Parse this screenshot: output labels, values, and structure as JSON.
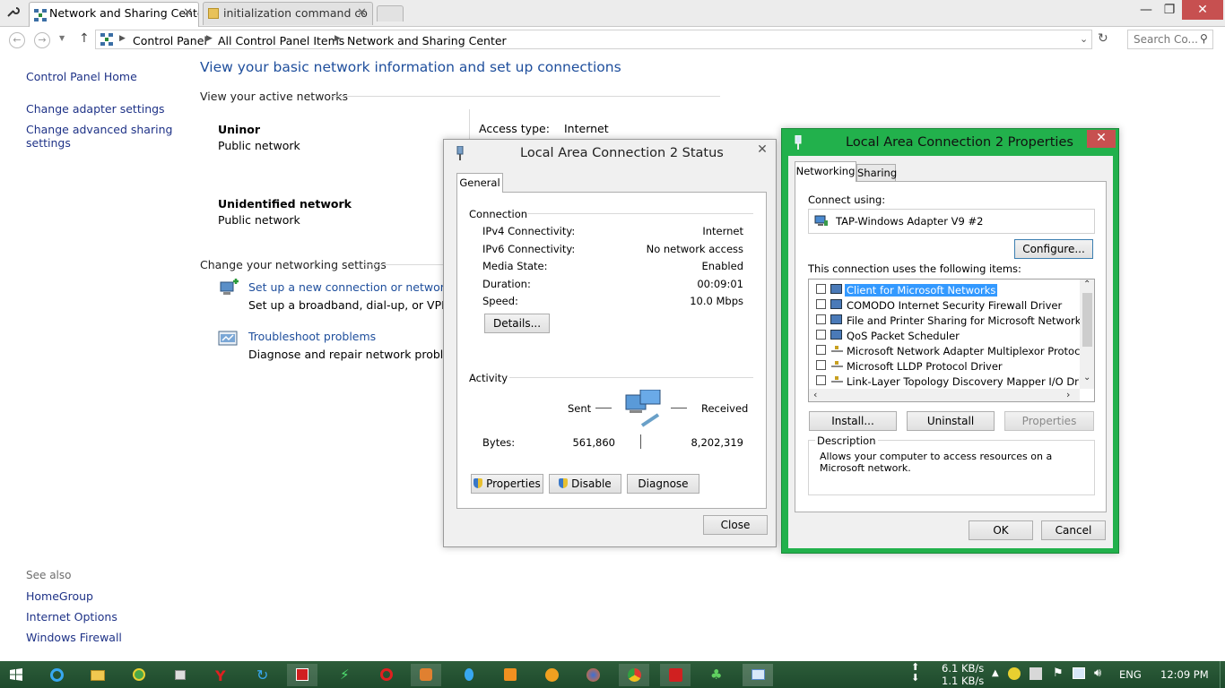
{
  "browser": {
    "tabs": [
      {
        "label": "Network and Sharing Cente",
        "active": true
      },
      {
        "label": "initialization command co",
        "active": false
      }
    ]
  },
  "address": {
    "crumbs": [
      "Control Panel",
      "All Control Panel Items",
      "Network and Sharing Center"
    ],
    "search_placeholder": "Search Co..."
  },
  "left_pane": {
    "home": "Control Panel Home",
    "adapter": "Change adapter settings",
    "advanced_line1": "Change advanced sharing",
    "advanced_line2": "settings",
    "see_also": "See also",
    "links": [
      "HomeGroup",
      "Internet Options",
      "Windows Firewall"
    ]
  },
  "main": {
    "title": "View your basic network information and set up connections",
    "active_networks_label": "View your active networks",
    "networks": [
      {
        "name": "Uninor",
        "type": "Public network"
      },
      {
        "name": "Unidentified network",
        "type": "Public network"
      }
    ],
    "access_type_label": "Access type:",
    "access_type_value": "Internet",
    "change_settings_label": "Change your networking settings",
    "setup_link": "Set up a new connection or network",
    "setup_desc": "Set up a broadband, dial-up, or VPN conn",
    "troubleshoot_link": "Troubleshoot problems",
    "troubleshoot_desc": "Diagnose and repair network problems, o"
  },
  "status_dialog": {
    "title": "Local Area Connection 2 Status",
    "tab": "General",
    "connection_group": "Connection",
    "rows": [
      {
        "key": "IPv4 Connectivity:",
        "value": "Internet"
      },
      {
        "key": "IPv6 Connectivity:",
        "value": "No network access"
      },
      {
        "key": "Media State:",
        "value": "Enabled"
      },
      {
        "key": "Duration:",
        "value": "00:09:01"
      },
      {
        "key": "Speed:",
        "value": "10.0 Mbps"
      }
    ],
    "details_button": "Details...",
    "activity_group": "Activity",
    "sent_label": "Sent",
    "received_label": "Received",
    "bytes_label": "Bytes:",
    "bytes_sent": "561,860",
    "bytes_received": "8,202,319",
    "properties_button": "Properties",
    "disable_button": "Disable",
    "diagnose_button": "Diagnose",
    "close_button": "Close"
  },
  "props_dialog": {
    "title": "Local Area Connection 2 Properties",
    "tabs": [
      "Networking",
      "Sharing"
    ],
    "connect_using_label": "Connect using:",
    "adapter": "TAP-Windows Adapter V9 #2",
    "configure_button": "Configure...",
    "items_label": "This connection uses the following items:",
    "items": [
      {
        "label": "Client for Microsoft Networks",
        "checked": false,
        "selected": true,
        "icon": "network-client-icon"
      },
      {
        "label": "COMODO Internet Security Firewall Driver",
        "checked": false,
        "selected": false,
        "icon": "network-service-icon"
      },
      {
        "label": "File and Printer Sharing for Microsoft Networks",
        "checked": false,
        "selected": false,
        "icon": "network-service-icon"
      },
      {
        "label": "QoS Packet Scheduler",
        "checked": false,
        "selected": false,
        "icon": "network-service-icon"
      },
      {
        "label": "Microsoft Network Adapter Multiplexor Protocol",
        "checked": false,
        "selected": false,
        "icon": "protocol-icon"
      },
      {
        "label": "Microsoft LLDP Protocol Driver",
        "checked": false,
        "selected": false,
        "icon": "protocol-icon"
      },
      {
        "label": "Link-Layer Topology Discovery Mapper I/O Driver",
        "checked": false,
        "selected": false,
        "icon": "protocol-icon"
      }
    ],
    "install_button": "Install...",
    "uninstall_button": "Uninstall",
    "properties_button": "Properties",
    "description_label": "Description",
    "description_text": "Allows your computer to access resources on a Microsoft network.",
    "ok_button": "OK",
    "cancel_button": "Cancel",
    "accent": "#22b14c"
  },
  "taskbar": {
    "upload_speed": "6.1 KB/s",
    "download_speed": "1.1 KB/s",
    "language": "ENG",
    "time": "12:09 PM"
  }
}
